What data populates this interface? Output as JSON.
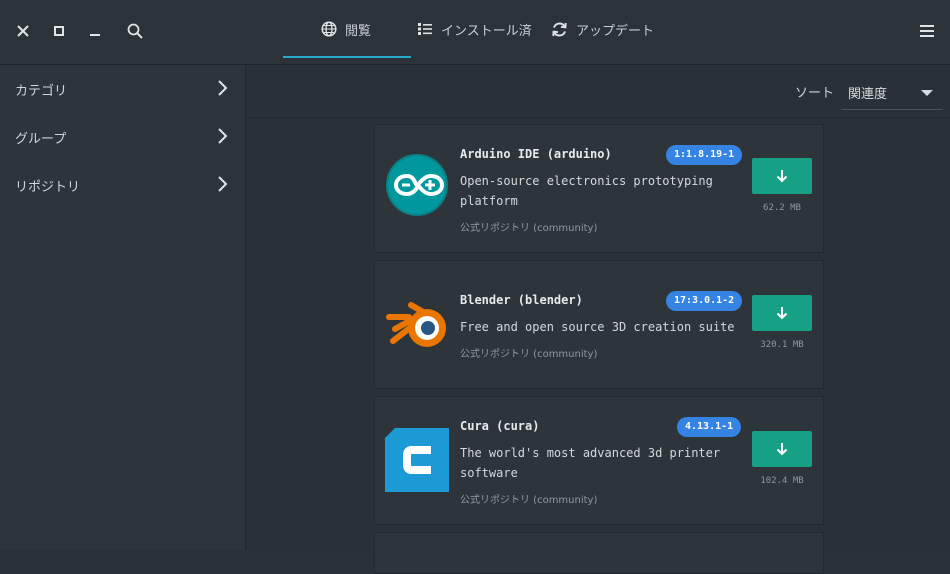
{
  "window": {
    "close_icon": "close-icon",
    "maximize_icon": "maximize-icon",
    "minimize_icon": "minimize-icon",
    "search_icon": "search-icon",
    "menu_icon": "hamburger-menu-icon"
  },
  "tabs": [
    {
      "label": "閲覧",
      "icon": "globe-icon",
      "active": true
    },
    {
      "label": "インストール済",
      "icon": "list-icon",
      "active": false
    },
    {
      "label": "アップデート",
      "icon": "refresh-icon",
      "active": false
    }
  ],
  "sidebar": {
    "items": [
      {
        "label": "カテゴリ"
      },
      {
        "label": "グループ"
      },
      {
        "label": "リポジトリ"
      }
    ]
  },
  "sort": {
    "label": "ソート",
    "value": "関連度"
  },
  "packages": [
    {
      "name": "Arduino IDE (arduino)",
      "version": "1:1.8.19-1",
      "description": "Open-source electronics prototyping platform",
      "repo": "公式リポジトリ (community)",
      "size": "62.2 MB",
      "icon": "arduino-logo-icon"
    },
    {
      "name": "Blender (blender)",
      "version": "17:3.0.1-2",
      "description": "Free and open source 3D creation suite",
      "repo": "公式リポジトリ (community)",
      "size": "320.1 MB",
      "icon": "blender-logo-icon"
    },
    {
      "name": "Cura (cura)",
      "version": "4.13.1-1",
      "description": "The world's most advanced 3d printer software",
      "repo": "公式リポジトリ (community)",
      "size": "102.4 MB",
      "icon": "cura-logo-icon"
    }
  ],
  "colors": {
    "accent": "#26a9cf",
    "badge": "#3584e4",
    "download_button": "#16a085",
    "background": "#2a3137"
  }
}
